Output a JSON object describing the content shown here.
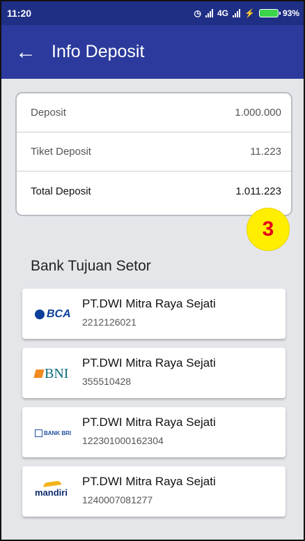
{
  "status_bar": {
    "time": "11:20",
    "network": "4G",
    "battery": "93%"
  },
  "app_bar": {
    "title": "Info Deposit"
  },
  "summary": {
    "rows": [
      {
        "label": "Deposit",
        "value": "1.000.000"
      },
      {
        "label": "Tiket Deposit",
        "value": "11.223"
      },
      {
        "label": "Total Deposit",
        "value": "1.011.223"
      }
    ]
  },
  "badge": {
    "label": "3"
  },
  "section": {
    "title": "Bank Tujuan Setor"
  },
  "banks": [
    {
      "logo": "BCA",
      "name": "PT.DWI Mitra Raya Sejati",
      "account": "2212126021"
    },
    {
      "logo": "BNI",
      "name": "PT.DWI Mitra Raya Sejati",
      "account": "355510428"
    },
    {
      "logo": "BANK BRI",
      "name": "PT.DWI Mitra Raya Sejati",
      "account": "122301000162304"
    },
    {
      "logo": "mandiri",
      "name": "PT.DWI Mitra Raya Sejati",
      "account": "1240007081277"
    }
  ],
  "colors": {
    "app_bar": "#2b3a9c",
    "status_bar": "#1f2f86",
    "background": "#e4e6ea",
    "badge_fill": "#ffee00",
    "badge_text": "#e4001a"
  }
}
